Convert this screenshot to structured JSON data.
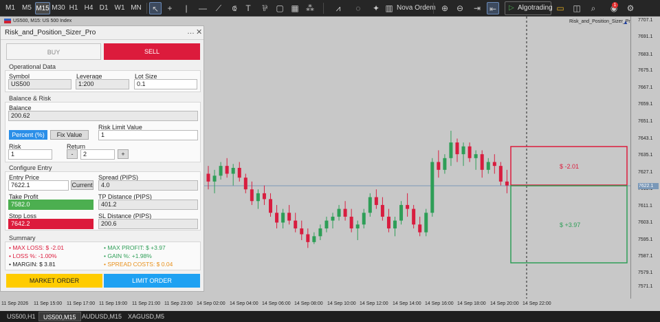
{
  "toolbar": {
    "timeframes": [
      "M1",
      "M5",
      "M15",
      "M30",
      "H1",
      "H4",
      "D1",
      "W1",
      "MN"
    ],
    "active_timeframe": "M15",
    "new_order": "Nova Ordem",
    "algotrading": "Algotrading",
    "notification_count": "1"
  },
  "chart": {
    "symbol_label": "US500, M15: US 500 Index",
    "indicator_label": "Risk_and_Position_Sizer_Pro",
    "current_price": "7622.1",
    "loss_box_label": "$ -2.01",
    "profit_box_label": "$ +3.97",
    "price_ticks": [
      "7707.1",
      "7691.1",
      "7683.1",
      "7675.1",
      "7667.1",
      "7659.1",
      "7651.1",
      "7643.1",
      "7635.1",
      "7627.1",
      "7619.1",
      "7611.1",
      "7603.1",
      "7595.1",
      "7587.1",
      "7579.1",
      "7571.1"
    ],
    "time_ticks": [
      "11 Sep 2026",
      "11 Sep 15:00",
      "11 Sep 17:00",
      "11 Sep 19:00",
      "11 Sep 21:00",
      "11 Sep 23:00",
      "14 Sep 02:00",
      "14 Sep 04:00",
      "14 Sep 06:00",
      "14 Sep 08:00",
      "14 Sep 10:00",
      "14 Sep 12:00",
      "14 Sep 14:00",
      "14 Sep 16:00",
      "14 Sep 18:00",
      "14 Sep 20:00",
      "14 Sep 22:00"
    ],
    "candles": [
      [
        7628,
        7632,
        7620,
        7624
      ],
      [
        7624,
        7630,
        7618,
        7627
      ],
      [
        7627,
        7634,
        7625,
        7632
      ],
      [
        7632,
        7636,
        7626,
        7628
      ],
      [
        7628,
        7633,
        7622,
        7631
      ],
      [
        7631,
        7634,
        7624,
        7626
      ],
      [
        7626,
        7628,
        7618,
        7620
      ],
      [
        7620,
        7624,
        7612,
        7614
      ],
      [
        7614,
        7620,
        7610,
        7618
      ],
      [
        7618,
        7622,
        7612,
        7615
      ],
      [
        7615,
        7618,
        7606,
        7608
      ],
      [
        7608,
        7612,
        7600,
        7603
      ],
      [
        7603,
        7610,
        7600,
        7608
      ],
      [
        7608,
        7612,
        7602,
        7604
      ],
      [
        7604,
        7608,
        7598,
        7600
      ],
      [
        7600,
        7604,
        7594,
        7597
      ],
      [
        7597,
        7600,
        7590,
        7593
      ],
      [
        7593,
        7598,
        7592,
        7596
      ],
      [
        7596,
        7602,
        7594,
        7600
      ],
      [
        7600,
        7606,
        7598,
        7604
      ],
      [
        7604,
        7608,
        7600,
        7606
      ],
      [
        7606,
        7612,
        7604,
        7610
      ],
      [
        7610,
        7614,
        7604,
        7606
      ],
      [
        7606,
        7610,
        7598,
        7600
      ],
      [
        7600,
        7604,
        7594,
        7602
      ],
      [
        7602,
        7610,
        7600,
        7608
      ],
      [
        7608,
        7618,
        7606,
        7616
      ],
      [
        7616,
        7620,
        7610,
        7612
      ],
      [
        7612,
        7616,
        7604,
        7606
      ],
      [
        7606,
        7610,
        7598,
        7600
      ],
      [
        7600,
        7606,
        7596,
        7604
      ],
      [
        7604,
        7614,
        7602,
        7612
      ],
      [
        7612,
        7618,
        7606,
        7610
      ],
      [
        7610,
        7612,
        7600,
        7602
      ],
      [
        7602,
        7606,
        7596,
        7598
      ],
      [
        7598,
        7610,
        7596,
        7608
      ],
      [
        7608,
        7636,
        7606,
        7634
      ],
      [
        7634,
        7640,
        7626,
        7630
      ],
      [
        7630,
        7638,
        7628,
        7636
      ],
      [
        7636,
        7650,
        7632,
        7644
      ],
      [
        7644,
        7646,
        7634,
        7638
      ],
      [
        7638,
        7644,
        7632,
        7642
      ],
      [
        7642,
        7644,
        7634,
        7636
      ],
      [
        7636,
        7640,
        7630,
        7638
      ],
      [
        7638,
        7640,
        7626,
        7630
      ],
      [
        7630,
        7636,
        7628,
        7634
      ],
      [
        7634,
        7638,
        7628,
        7632
      ],
      [
        7632,
        7634,
        7622,
        7624
      ],
      [
        7624,
        7630,
        7618,
        7622
      ]
    ]
  },
  "panel": {
    "title": "Risk_and_Position_Sizer_Pro",
    "buy_label": "BUY",
    "sell_label": "SELL",
    "operational_title": "Operational Data",
    "symbol_label": "Symbol",
    "symbol_value": "US500",
    "leverage_label": "Leverage",
    "leverage_value": "1:200",
    "lot_label": "Lot Size",
    "lot_value": "0.1",
    "balance_title": "Balance & Risk",
    "balance_label": "Balance",
    "balance_value": "200.62",
    "percent_btn": "Percent (%)",
    "fix_btn": "Fix Value",
    "risk_limit_label": "Risk Limit Value",
    "risk_limit_value": "1",
    "risk_label": "Risk",
    "risk_value": "1",
    "return_label": "Return",
    "return_value": "2",
    "minus": "-",
    "plus": "+",
    "entry_title": "Configure Entry",
    "entry_price_label": "Entry Price",
    "entry_price_value": "7622.1",
    "current_btn": "Current",
    "spread_label": "Spread (PIPS)",
    "spread_value": "4.0",
    "tp_label": "Take Profit",
    "tp_value": "7582.0",
    "tp_dist_label": "TP Distance (PIPS)",
    "tp_dist_value": "401.2",
    "sl_label": "Stop Loss",
    "sl_value": "7642.2",
    "sl_dist_label": "SL Distance (PIPS)",
    "sl_dist_value": "200.6",
    "summary_title": "Summary",
    "max_loss": "MAX LOSS: $ -2.01",
    "loss_pct": "LOSS %: -1.00%",
    "margin": "MARGIN: $ 3.81",
    "max_profit": "MAX PROFIT: $ +3.97",
    "gain_pct": "GAIN %: +1.98%",
    "spread_costs": "SPREAD COSTS: $ 0.04",
    "market_btn": "MARKET ORDER",
    "limit_btn": "LIMIT ORDER"
  },
  "tabs": [
    "US500,H1",
    "US500,M15",
    "AUDUSD,M15",
    "XAGUSD,M5"
  ],
  "active_tab": "US500,M15",
  "colors": {
    "bull": "#2e9e57",
    "bear": "#d81d3f",
    "buy_bg": "#f4f4f4",
    "sell_bg": "#dc1b3c",
    "tp_bg": "#4caf50",
    "sl_bg": "#dc1b3c",
    "market": "#ffcc00",
    "limit": "#1ea1f2",
    "blue_btn": "#2b8fe8"
  }
}
